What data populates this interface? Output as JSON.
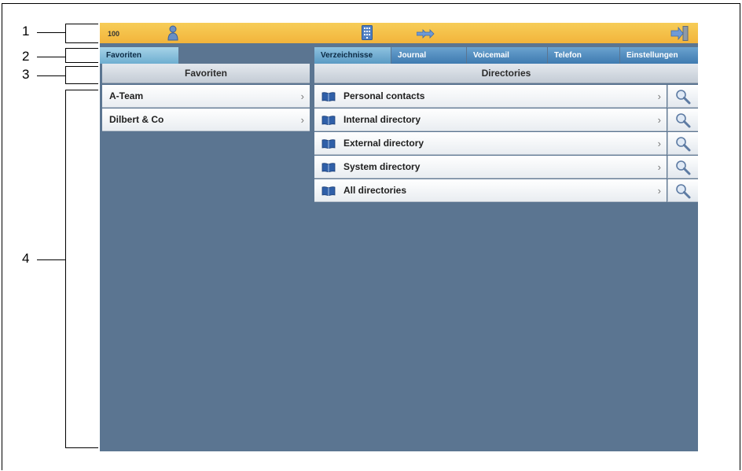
{
  "callouts": [
    "1",
    "2",
    "3",
    "4"
  ],
  "topbar": {
    "extension": "100",
    "icons": [
      "user-status-icon",
      "keypad-icon",
      "call-forward-icon",
      "logout-icon"
    ]
  },
  "tabs": {
    "favorites": "Favoriten",
    "items": [
      "Verzeichnisse",
      "Journal",
      "Voicemail",
      "Telefon",
      "Einstellungen"
    ],
    "active": "Verzeichnisse"
  },
  "favorites": {
    "header": "Favoriten",
    "items": [
      "A-Team",
      "Dilbert & Co"
    ]
  },
  "directories": {
    "header": "Directories",
    "items": [
      "Personal contacts",
      "Internal directory",
      "External directory",
      "System directory",
      "All directories"
    ]
  },
  "colors": {
    "topbar": "#f2b43b",
    "tab": "#3f7ab0",
    "background": "#5b7591"
  }
}
